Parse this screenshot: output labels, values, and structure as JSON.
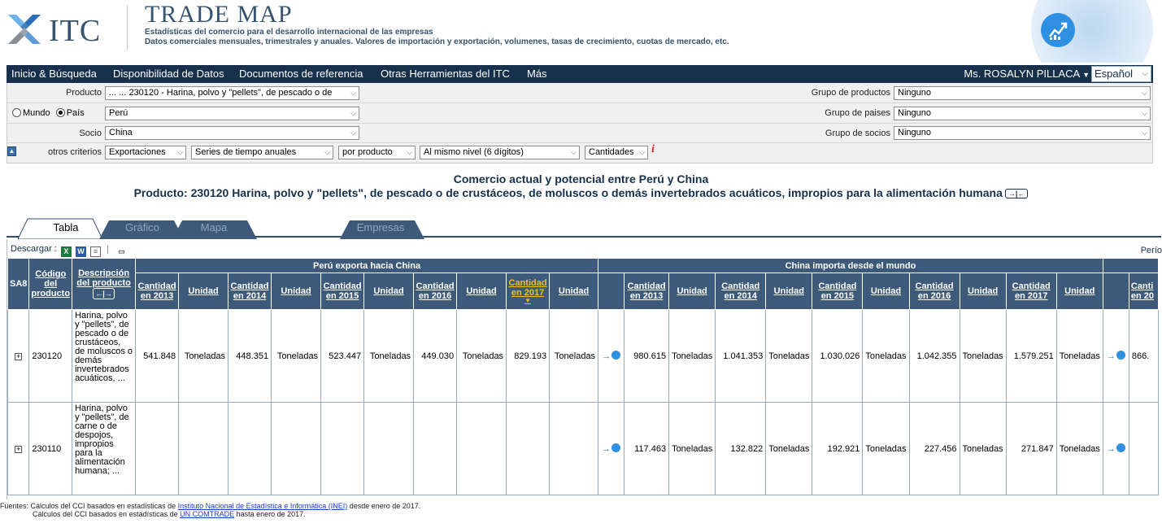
{
  "header": {
    "logo_text": "ITC",
    "title": "TRADE MAP",
    "subtitle1": "Estadísticas del comercio para el desarrollo internacional de las empresas",
    "subtitle2": "Datos comerciales mensuales, trimestrales y anuales. Valores de importación y exportación, volumenes, tasas de crecimiento, cuotas de mercado, etc."
  },
  "nav": {
    "items": [
      "Inicio & Búsqueda",
      "Disponibilidad de Datos",
      "Documentos de referencia",
      "Otras Herramientas del ITC",
      "Más"
    ],
    "user": "Ms. ROSALYN PILLACA",
    "language": "Español"
  },
  "filters": {
    "producto_label": "Producto",
    "producto_value": "... ... 230120 - Harina, polvo y \"pellets\", de pescado o de",
    "mundo_label": "Mundo",
    "pais_label": "País",
    "pais_value": "Perú",
    "socio_label": "Socio",
    "socio_value": "China",
    "otros_label": "otros criterios",
    "flujo": "Exportaciones",
    "series": "Series de tiempo anuales",
    "por": "por producto",
    "nivel": "Al mismo nivel (6 dígitos)",
    "medida": "Cantidades",
    "grupo_productos_label": "Grupo de productos",
    "grupo_productos_value": "Ninguno",
    "grupo_paises_label": "Grupo de paises",
    "grupo_paises_value": "Ninguno",
    "grupo_socios_label": "Grupo de socios",
    "grupo_socios_value": "Ninguno"
  },
  "titles": {
    "line1": "Comercio actual y potencial entre Perú y China",
    "line2": "Producto: 230120 Harina, polvo y \"pellets\", de pescado o de crustáceos, de moluscos o demás invertebrados acuáticos, impropios para la alimentación humana"
  },
  "tabs": [
    "Tabla",
    "Gráfico",
    "Mapa",
    "Empresas"
  ],
  "toolbar": {
    "descargar": "Descargar :",
    "periodo": "Perío"
  },
  "table": {
    "group1": "Perú exporta hacia China",
    "group2": "China importa desde el mundo",
    "col_sa8": "SA8",
    "col_codigo": "Código del producto",
    "col_desc": "Descripción del producto",
    "col_cant_2013": "Cantidad en 2013",
    "col_cant_2014": "Cantidad en 2014",
    "col_cant_2015": "Cantidad en 2015",
    "col_cant_2016": "Cantidad en 2016",
    "col_cant_2017": "Cantidad en 2017",
    "col_unidad": "Unidad",
    "col_cant_partial": "Canti en 20",
    "rows": [
      {
        "code": "230120",
        "desc": "Harina, polvo y \"pellets\", de pescado o de crustáceos, de moluscos o demás invertebrados acuáticos, ...",
        "peru": [
          "541.848",
          "Toneladas",
          "448.351",
          "Toneladas",
          "523.447",
          "Toneladas",
          "449.030",
          "Toneladas",
          "829.193",
          "Toneladas"
        ],
        "china": [
          "980.615",
          "Toneladas",
          "1.041.353",
          "Toneladas",
          "1.030.026",
          "Toneladas",
          "1.042.355",
          "Toneladas",
          "1.579.251",
          "Toneladas"
        ],
        "extra": "866."
      },
      {
        "code": "230110",
        "desc": "Harina, polvo y \"pellets\", de carne o de despojos, impropios para la alimentación humana; ...",
        "peru": [
          "",
          "",
          "",
          "",
          "",
          "",
          "",
          "",
          "",
          ""
        ],
        "china": [
          "117.463",
          "Toneladas",
          "132.822",
          "Toneladas",
          "192.921",
          "Toneladas",
          "227.456",
          "Toneladas",
          "271.847",
          "Toneladas"
        ],
        "extra": ""
      }
    ]
  },
  "footer": {
    "line1_pre": "Fuentes: Cálculos del CCI basados en estadísticas de ",
    "line1_link": "Instituto Nacional de Estadística e Informática (INEI)",
    "line1_post": " desde enero de 2017.",
    "line2_pre": "Cálculos del CCI basados en estadísticas de ",
    "line2_link": "UN COMTRADE",
    "line2_post": " hasta enero de 2017."
  },
  "colors": {
    "navy": "#17304b",
    "header_blue": "#3d5a7a",
    "highlight": "#f0c020"
  }
}
